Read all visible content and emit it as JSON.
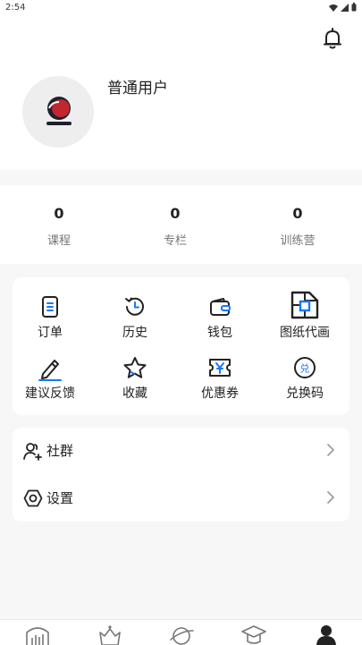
{
  "status": {
    "time": "2:54"
  },
  "profile": {
    "username": "普通用户"
  },
  "stats": [
    {
      "value": "0",
      "label": "课程"
    },
    {
      "value": "0",
      "label": "专栏"
    },
    {
      "value": "0",
      "label": "训练营"
    }
  ],
  "grid": [
    {
      "label": "订单",
      "icon": "order-icon"
    },
    {
      "label": "历史",
      "icon": "history-icon"
    },
    {
      "label": "钱包",
      "icon": "wallet-icon"
    },
    {
      "label": "图纸代画",
      "icon": "blueprint-icon"
    },
    {
      "label": "建议反馈",
      "icon": "pencil-icon"
    },
    {
      "label": "收藏",
      "icon": "star-icon"
    },
    {
      "label": "优惠券",
      "icon": "coupon-icon"
    },
    {
      "label": "兑换码",
      "icon": "redeem-code-icon",
      "glyph": "兑"
    }
  ],
  "list": [
    {
      "label": "社群",
      "icon": "community-icon"
    },
    {
      "label": "设置",
      "icon": "settings-icon"
    }
  ],
  "tabbar": [
    {
      "icon": "home-chart-icon"
    },
    {
      "icon": "crown-icon"
    },
    {
      "icon": "planet-icon"
    },
    {
      "icon": "graduation-cap-icon"
    },
    {
      "icon": "profile-icon",
      "active": true
    }
  ],
  "colors": {
    "accent": "#1677ff",
    "page_bg": "#f7f7f7",
    "card_bg": "#ffffff",
    "avatar_red": "#c0282d"
  }
}
